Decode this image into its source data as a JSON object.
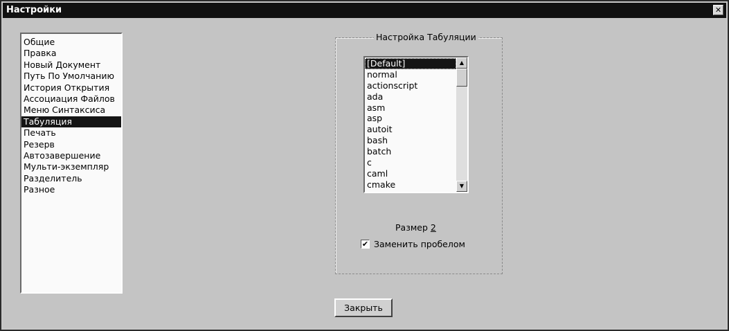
{
  "window": {
    "title": "Настройки",
    "close_glyph": "✕"
  },
  "sidebar": {
    "items": [
      {
        "label": "Общие",
        "selected": false
      },
      {
        "label": "Правка",
        "selected": false
      },
      {
        "label": "Новый Документ",
        "selected": false
      },
      {
        "label": "Путь По Умолчанию",
        "selected": false
      },
      {
        "label": "История Открытия",
        "selected": false
      },
      {
        "label": "Ассоциация Файлов",
        "selected": false
      },
      {
        "label": "Меню Синтаксиса",
        "selected": false
      },
      {
        "label": "Табуляция",
        "selected": true
      },
      {
        "label": "Печать",
        "selected": false
      },
      {
        "label": "Резерв",
        "selected": false
      },
      {
        "label": "Автозавершение",
        "selected": false
      },
      {
        "label": "Мульти-экземпляр",
        "selected": false
      },
      {
        "label": "Разделитель",
        "selected": false
      },
      {
        "label": "Разное",
        "selected": false
      }
    ]
  },
  "tab_settings": {
    "group_title": "Настройка Табуляции",
    "languages": [
      {
        "label": "[Default]",
        "selected": true
      },
      {
        "label": "normal",
        "selected": false
      },
      {
        "label": "actionscript",
        "selected": false
      },
      {
        "label": "ada",
        "selected": false
      },
      {
        "label": "asm",
        "selected": false
      },
      {
        "label": "asp",
        "selected": false
      },
      {
        "label": "autoit",
        "selected": false
      },
      {
        "label": "bash",
        "selected": false
      },
      {
        "label": "batch",
        "selected": false
      },
      {
        "label": "c",
        "selected": false
      },
      {
        "label": "caml",
        "selected": false
      },
      {
        "label": "cmake",
        "selected": false
      }
    ],
    "scroll_up_glyph": "▲",
    "scroll_down_glyph": "▼",
    "size_label": "Размер",
    "size_value": "2",
    "replace_with_spaces_label": "Заменить пробелом",
    "replace_with_spaces_checked": true,
    "check_glyph": "✔"
  },
  "footer": {
    "close_button_label": "Закрыть"
  },
  "colors": {
    "titlebar": "#111111",
    "dialog_background": "#c4c4c4",
    "selection": "#151515"
  }
}
